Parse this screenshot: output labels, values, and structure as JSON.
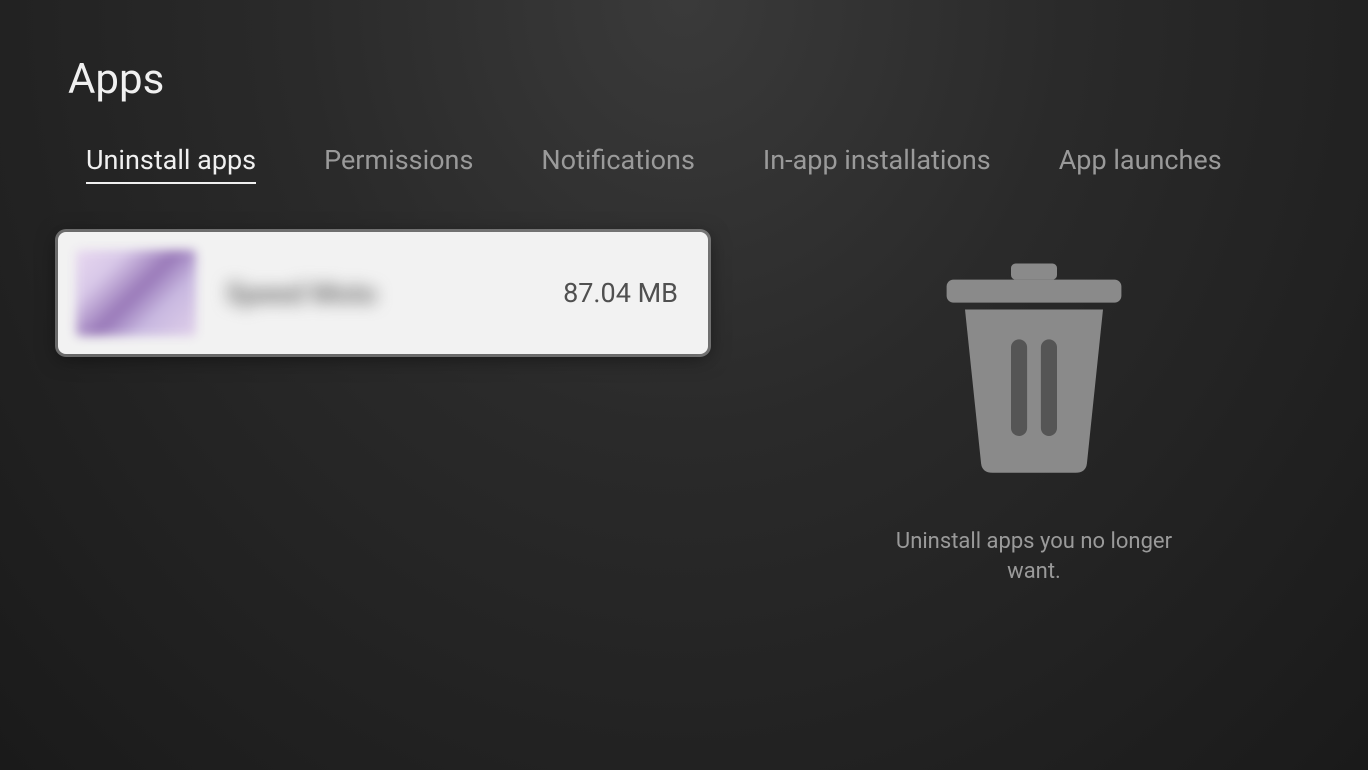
{
  "header": {
    "title": "Apps"
  },
  "tabs": {
    "uninstall": "Uninstall apps",
    "permissions": "Permissions",
    "notifications": "Notifications",
    "in_app_installations": "In-app installations",
    "app_launches": "App launches"
  },
  "app_list": {
    "items": [
      {
        "name": "Speed Moto",
        "size": "87.04 MB"
      }
    ]
  },
  "info_panel": {
    "help_text": "Uninstall apps you no longer want."
  }
}
